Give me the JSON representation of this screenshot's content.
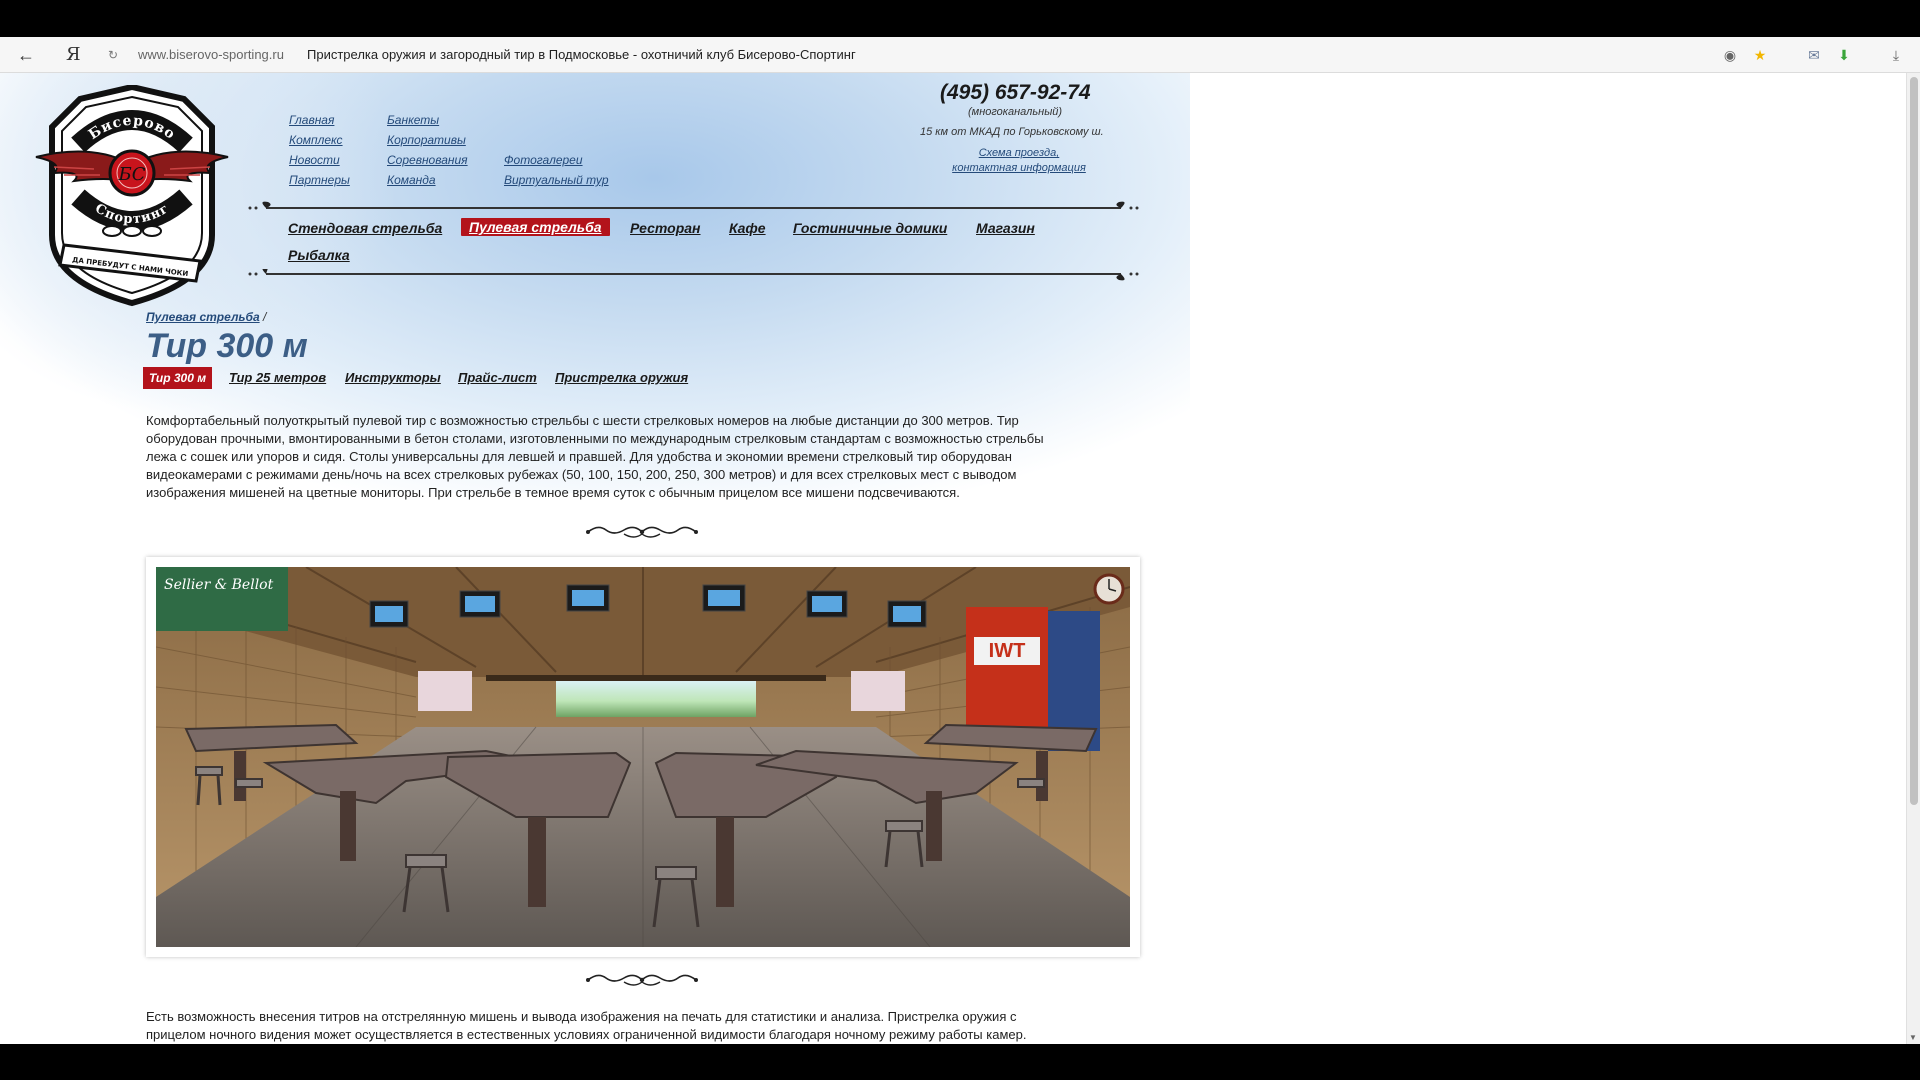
{
  "browser": {
    "url_domain": "www.biserovo-sporting.ru",
    "page_title": "Пристрелка оружия и загородный тир в Подмосковье - охотничий клуб Бисерово-Спортинг",
    "icons": [
      "back-icon",
      "yandex-icon",
      "reload-icon",
      "protect-icon",
      "star-icon",
      "mail-icon",
      "download-arrow-icon",
      "downloads-icon"
    ]
  },
  "logo": {
    "top_text": "Бисерово",
    "bottom_text": "Спортинг",
    "ribbon_text": "ДА ПРЕБУДУТ С НАМИ ЧОКИ",
    "monogram": "БС"
  },
  "top_links": {
    "col1": [
      "Главная",
      "Комплекс",
      "Новости",
      "Партнеры"
    ],
    "col2": [
      "Банкеты",
      "Корпоративы",
      "Соревнования",
      "Команда"
    ],
    "col3": [
      "Фотогалереи",
      "Виртуальный тур"
    ]
  },
  "contacts": {
    "phone": "(495) 657-92-74",
    "phone_note": "(многоканальный)",
    "distance": "15 км от МКАД по Горьковскому ш.",
    "schema_line1": "Схема проезда,",
    "schema_line2": "контактная информация"
  },
  "main_menu": [
    {
      "label": "Стендовая стрельба",
      "active": false
    },
    {
      "label": "Пулевая стрельба",
      "active": true
    },
    {
      "label": "Ресторан",
      "active": false
    },
    {
      "label": "Кафе",
      "active": false
    },
    {
      "label": "Гостиничные домики",
      "active": false
    },
    {
      "label": "Магазин",
      "active": false
    },
    {
      "label": "Рыбалка",
      "active": false
    }
  ],
  "breadcrumb": {
    "link": "Пулевая стрельба",
    "separator": "/"
  },
  "title": "Тир 300 м",
  "subtabs": [
    {
      "label": "Тир 300 м",
      "active": true
    },
    {
      "label": "Тир 25 метров",
      "active": false
    },
    {
      "label": "Инструкторы",
      "active": false
    },
    {
      "label": "Прайс-лист",
      "active": false
    },
    {
      "label": "Пристрелка оружия",
      "active": false
    }
  ],
  "paragraph1": [
    "Комфортабельный полуоткрытый пулевой тир с возможностью стрельбы с шести стрелковых номеров на любые дистанции до 300 метров. Тир",
    "оборудован прочными, вмонтированными в бетон столами, изготовленными по международным стрелковым стандартам с возможностью стрельбы",
    "лежа с сошек или упоров и сидя. Столы универсальны для левшей и правшей. Для удобства и экономии времени стрелковый тир оборудован",
    "видеокамерами с режимами день/ночь на всех стрелковых рубежах (50, 100, 150, 200, 250, 300 метров) и для всех стрелковых мест с выводом",
    "изображения мишеней на цветные мониторы. При стрельбе в темное время суток с обычным прицелом все мишени подсвечиваются."
  ],
  "photo_signs": {
    "left_banner": "Sellier & Bellot",
    "right_banner": "IWT"
  },
  "paragraph2": [
    "Есть возможность внесения титров на отстрелянную мишень и вывода изображения на печать для статистики и анализа. Пристрелка оружия с",
    "прицелом ночного видения может осуществляется в естественных условиях ограниченной видимости благодаря ночному режиму работы камер."
  ],
  "colors": {
    "accent_red": "#b3131b",
    "title_blue": "#3c5e86",
    "link_blue": "#244a7a"
  }
}
